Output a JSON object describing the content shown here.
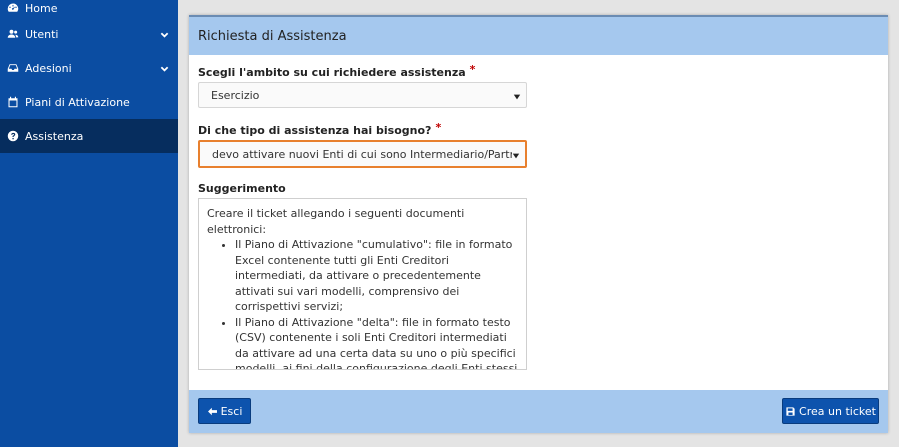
{
  "sidebar": {
    "items": [
      {
        "label": "Home",
        "icon": "dashboard-icon"
      },
      {
        "label": "Utenti",
        "icon": "users-icon"
      },
      {
        "label": "Adesioni",
        "icon": "inbox-icon"
      },
      {
        "label": "Piani di Attivazione",
        "icon": "calendar-icon"
      },
      {
        "label": "Assistenza",
        "icon": "question-circle-icon"
      }
    ]
  },
  "panel": {
    "title": "Richiesta di Assistenza",
    "ambito_label": "Scegli l'ambito su cui richiedere assistenza",
    "ambito_value": "Esercizio",
    "tipo_label": "Di che tipo di assistenza hai bisogno?",
    "tipo_value": "devo attivare nuovi Enti di cui sono Intermediario/Partner Tecnologico",
    "required_mark": "*",
    "hint_label": "Suggerimento",
    "hint_intro": "Creare il ticket allegando i seguenti documenti elettronici:",
    "hint_items": [
      "Il Piano di Attivazione \"cumulativo\": file in formato Excel contenente tutti gli Enti Creditori intermediati, da attivare o precedentemente attivati sui vari modelli, comprensivo dei corrispettivi servizi;",
      "Il Piano di Attivazione \"delta\": file in formato testo (CSV) contenente i soli Enti Creditori intermediati da attivare ad una certa data su uno o più specifici modelli, ai fini della configurazione degli Enti stessi sul Nodo dei Pagamenti-SPC."
    ]
  },
  "footer": {
    "esci_label": "Esci",
    "crea_label": "Crea un ticket"
  }
}
